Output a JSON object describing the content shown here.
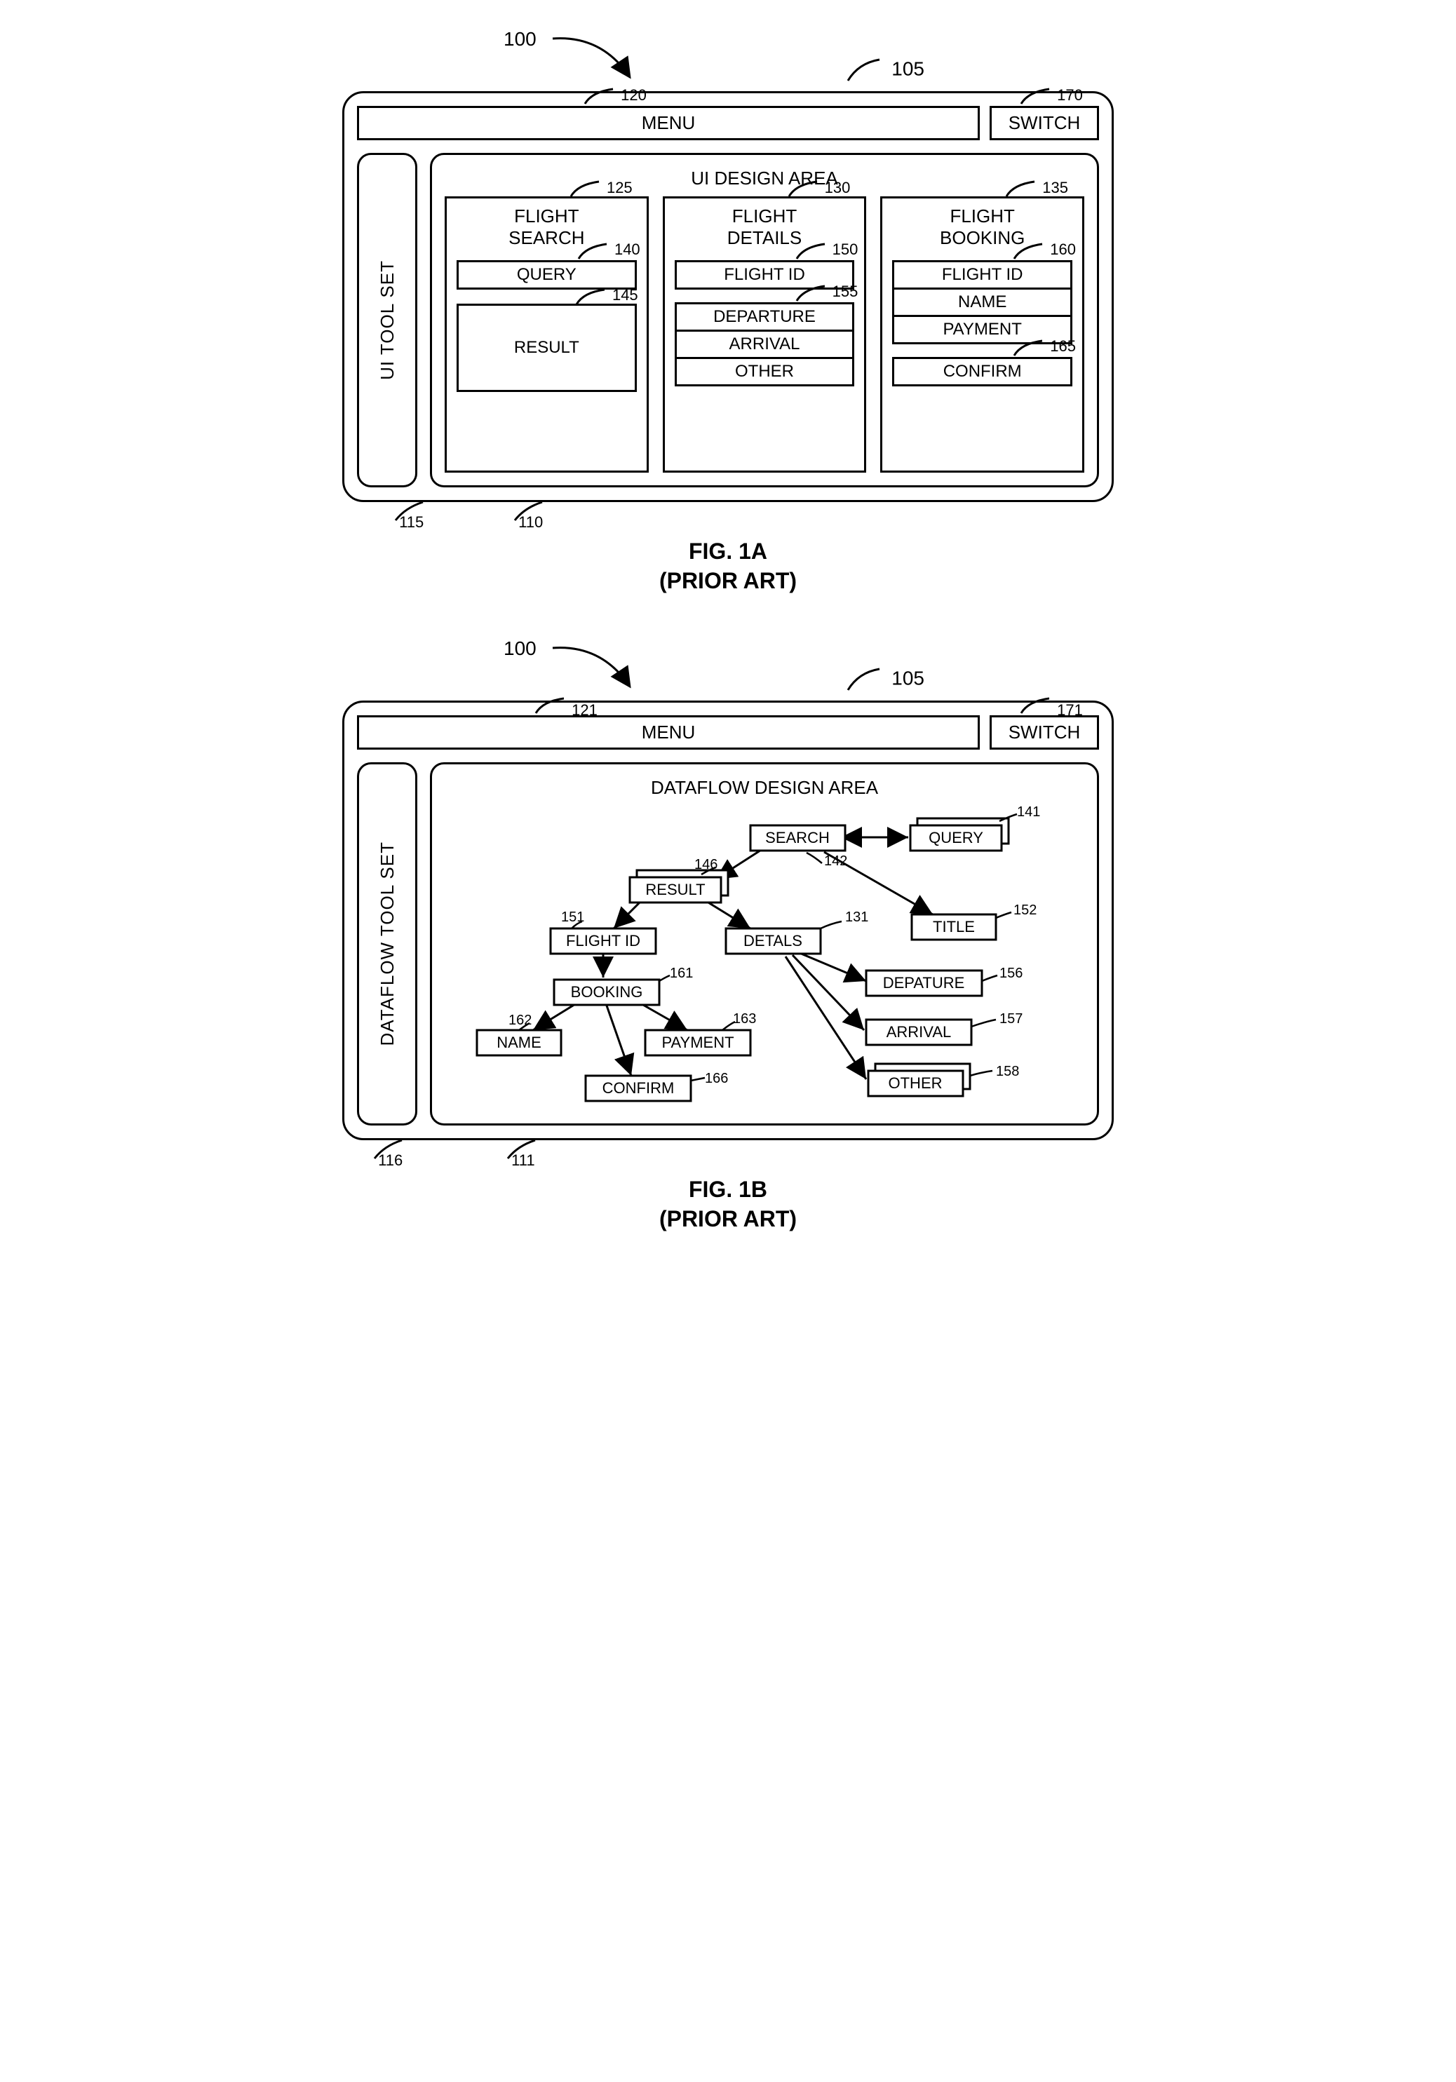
{
  "fig1a": {
    "title_line1": "FIG. 1A",
    "title_line2": "(PRIOR ART)",
    "ref_top": "100",
    "ref_panel": "105",
    "menu": {
      "label": "MENU",
      "ref": "120"
    },
    "switch": {
      "label": "SWITCH",
      "ref": "170"
    },
    "sidebar": {
      "label": "UI TOOL SET",
      "ref": "115"
    },
    "area": {
      "label": "UI DESIGN AREA",
      "ref": "110"
    },
    "cards": [
      {
        "title": "FLIGHT\nSEARCH",
        "ref": "125",
        "fields": [
          {
            "label": "QUERY",
            "ref": "140"
          }
        ],
        "big": {
          "label": "RESULT",
          "ref": "145"
        }
      },
      {
        "title": "FLIGHT\nDETAILS",
        "ref": "130",
        "fields": [
          {
            "label": "FLIGHT ID",
            "ref": "150"
          }
        ],
        "stack": {
          "ref": "155",
          "items": [
            "DEPARTURE",
            "ARRIVAL",
            "OTHER"
          ]
        }
      },
      {
        "title": "FLIGHT\nBOOKING",
        "ref": "135",
        "stack": {
          "ref": "160",
          "items": [
            "FLIGHT ID",
            "NAME",
            "PAYMENT"
          ]
        },
        "after": {
          "label": "CONFIRM",
          "ref": "165"
        }
      }
    ]
  },
  "fig1b": {
    "title_line1": "FIG. 1B",
    "title_line2": "(PRIOR ART)",
    "ref_top": "100",
    "ref_panel": "105",
    "menu": {
      "label": "MENU",
      "ref": "121"
    },
    "switch": {
      "label": "SWITCH",
      "ref": "171"
    },
    "sidebar": {
      "label": "DATAFLOW TOOL SET",
      "ref": "116"
    },
    "area": {
      "label": "DATAFLOW DESIGN AREA",
      "ref": "111"
    },
    "nodes": {
      "search": {
        "label": "SEARCH",
        "ref": "142"
      },
      "query": {
        "label": "QUERY",
        "ref": "141"
      },
      "result": {
        "label": "RESULT",
        "ref": "146"
      },
      "flightid": {
        "label": "FLIGHT ID",
        "ref": "151"
      },
      "details": {
        "label": "DETALS",
        "ref": "131"
      },
      "title": {
        "label": "TITLE",
        "ref": "152"
      },
      "booking": {
        "label": "BOOKING",
        "ref": "161"
      },
      "departure": {
        "label": "DEPATURE",
        "ref": "156"
      },
      "name": {
        "label": "NAME",
        "ref": "162"
      },
      "payment": {
        "label": "PAYMENT",
        "ref": "163"
      },
      "arrival": {
        "label": "ARRIVAL",
        "ref": "157"
      },
      "confirm": {
        "label": "CONFIRM",
        "ref": "166"
      },
      "other": {
        "label": "OTHER",
        "ref": "158"
      }
    }
  }
}
